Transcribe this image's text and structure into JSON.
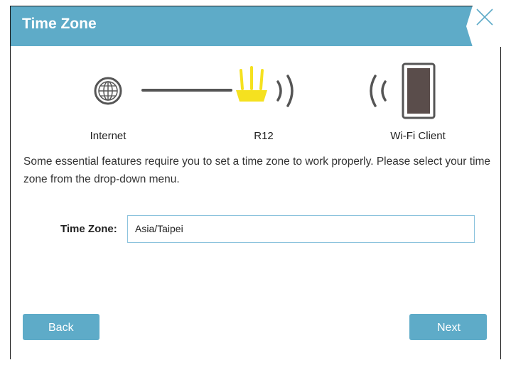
{
  "header": {
    "title": "Time Zone",
    "close_icon": "close-x-icon",
    "color": "#5eabc8"
  },
  "topology": {
    "nodes": [
      {
        "label": "Internet",
        "icon": "globe-icon"
      },
      {
        "label": "R12",
        "icon": "router-icon",
        "color": "#f5e11f"
      },
      {
        "label": "Wi-Fi Client",
        "icon": "tablet-icon"
      }
    ]
  },
  "description": "Some essential features require you to set a time zone to work properly. Please select your time zone from the drop-down menu.",
  "timezone": {
    "label": "Time Zone:",
    "value": "Asia/Taipei"
  },
  "buttons": {
    "back": "Back",
    "next": "Next"
  }
}
